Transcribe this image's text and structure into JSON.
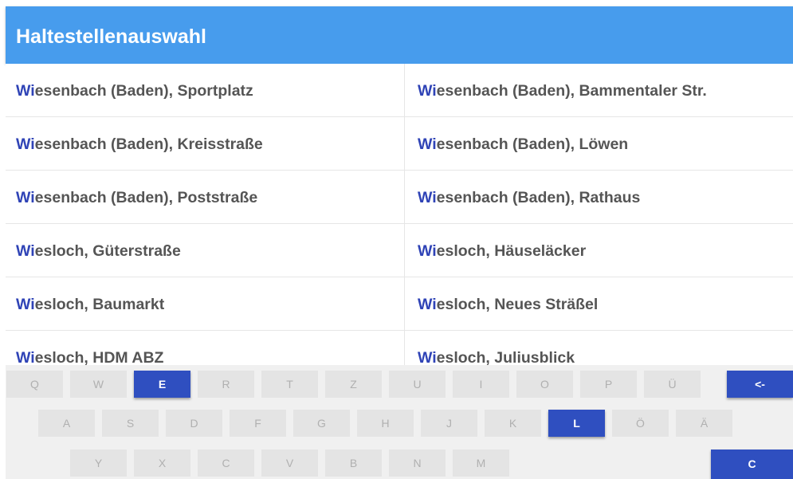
{
  "header": {
    "title": "Haltestellenauswahl"
  },
  "accent_color": "#479ced",
  "highlight_color": "#2f43b6",
  "rows": [
    {
      "left": {
        "hl": "Wi",
        "rest": "esenbach (Baden), Sportplatz"
      },
      "right": {
        "hl": "Wi",
        "rest": "esenbach (Baden), Bammentaler Str."
      }
    },
    {
      "left": {
        "hl": "Wi",
        "rest": "esenbach (Baden), Kreisstraße"
      },
      "right": {
        "hl": "Wi",
        "rest": "esenbach (Baden), Löwen"
      }
    },
    {
      "left": {
        "hl": "Wi",
        "rest": "esenbach (Baden), Poststraße"
      },
      "right": {
        "hl": "Wi",
        "rest": "esenbach (Baden), Rathaus"
      }
    },
    {
      "left": {
        "hl": "Wi",
        "rest": "esloch, Güterstraße"
      },
      "right": {
        "hl": "Wi",
        "rest": "esloch, Häuseläcker"
      }
    },
    {
      "left": {
        "hl": "Wi",
        "rest": "esloch, Baumarkt"
      },
      "right": {
        "hl": "Wi",
        "rest": "esloch, Neues Sträßel"
      }
    },
    {
      "left": {
        "hl": "Wi",
        "rest": "esloch, HDM ABZ"
      },
      "right": {
        "hl": "Wi",
        "rest": "esloch, Juliusblick"
      }
    }
  ],
  "keyboard": {
    "row1": [
      "Q",
      "W",
      "E",
      "R",
      "T",
      "Z",
      "U",
      "I",
      "O",
      "P",
      "Ü"
    ],
    "row2": [
      "A",
      "S",
      "D",
      "F",
      "G",
      "H",
      "J",
      "K",
      "L",
      "Ö",
      "Ä"
    ],
    "row3": [
      "Y",
      "X",
      "C",
      "V",
      "B",
      "N",
      "M"
    ],
    "active_keys": [
      "E",
      "L"
    ],
    "backspace_label": "<-",
    "clear_label": "C"
  }
}
